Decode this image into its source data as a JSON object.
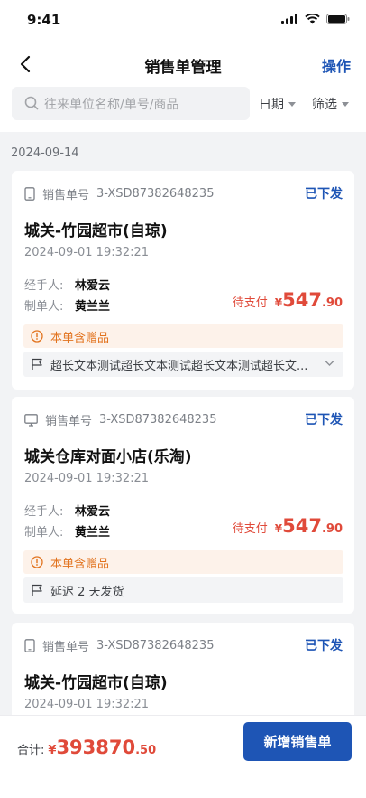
{
  "status_bar": {
    "time": "9:41"
  },
  "nav": {
    "title": "销售单管理",
    "action": "操作"
  },
  "search": {
    "placeholder": "往来单位名称/单号/商品"
  },
  "filters": {
    "date": "日期",
    "filter": "筛选"
  },
  "group_date": "2024-09-14",
  "orders": [
    {
      "order_label": "销售单号",
      "order_no": "3-XSD87382648235",
      "status": "已下发",
      "store": "城关-竹园超市(自琼)",
      "datetime": "2024-09-01  19:32:21",
      "handler_label": "经手人:",
      "handler": "林爱云",
      "maker_label": "制单人:",
      "maker": "黄兰兰",
      "pay_status": "待支付",
      "currency": "¥",
      "amount_int": "547",
      "amount_dec": ".90",
      "gift": "本单含赠品",
      "note": "超长文本测试超长文本测试超长文本测试超长文...",
      "device_icon": "phone-icon"
    },
    {
      "order_label": "销售单号",
      "order_no": "3-XSD87382648235",
      "status": "已下发",
      "store": "城关仓库对面小店(乐淘)",
      "datetime": "2024-09-01  19:32:21",
      "handler_label": "经手人:",
      "handler": "林爱云",
      "maker_label": "制单人:",
      "maker": "黄兰兰",
      "pay_status": "待支付",
      "currency": "¥",
      "amount_int": "547",
      "amount_dec": ".90",
      "gift": "本单含赠品",
      "note": "延迟 2 天发货",
      "device_icon": "desktop-icon"
    },
    {
      "order_label": "销售单号",
      "order_no": "3-XSD87382648235",
      "status": "已下发",
      "store": "城关-竹园超市(自琼)",
      "datetime": "2024-09-01  19:32:21",
      "device_icon": "phone-icon"
    }
  ],
  "footer": {
    "total_label": "合计:",
    "currency": "¥",
    "amount_int": "393870",
    "amount_dec": ".50",
    "button": "新增销售单"
  },
  "colors": {
    "accent": "#1e55b5",
    "price": "#e04a3a",
    "gift": "#e2731e"
  }
}
